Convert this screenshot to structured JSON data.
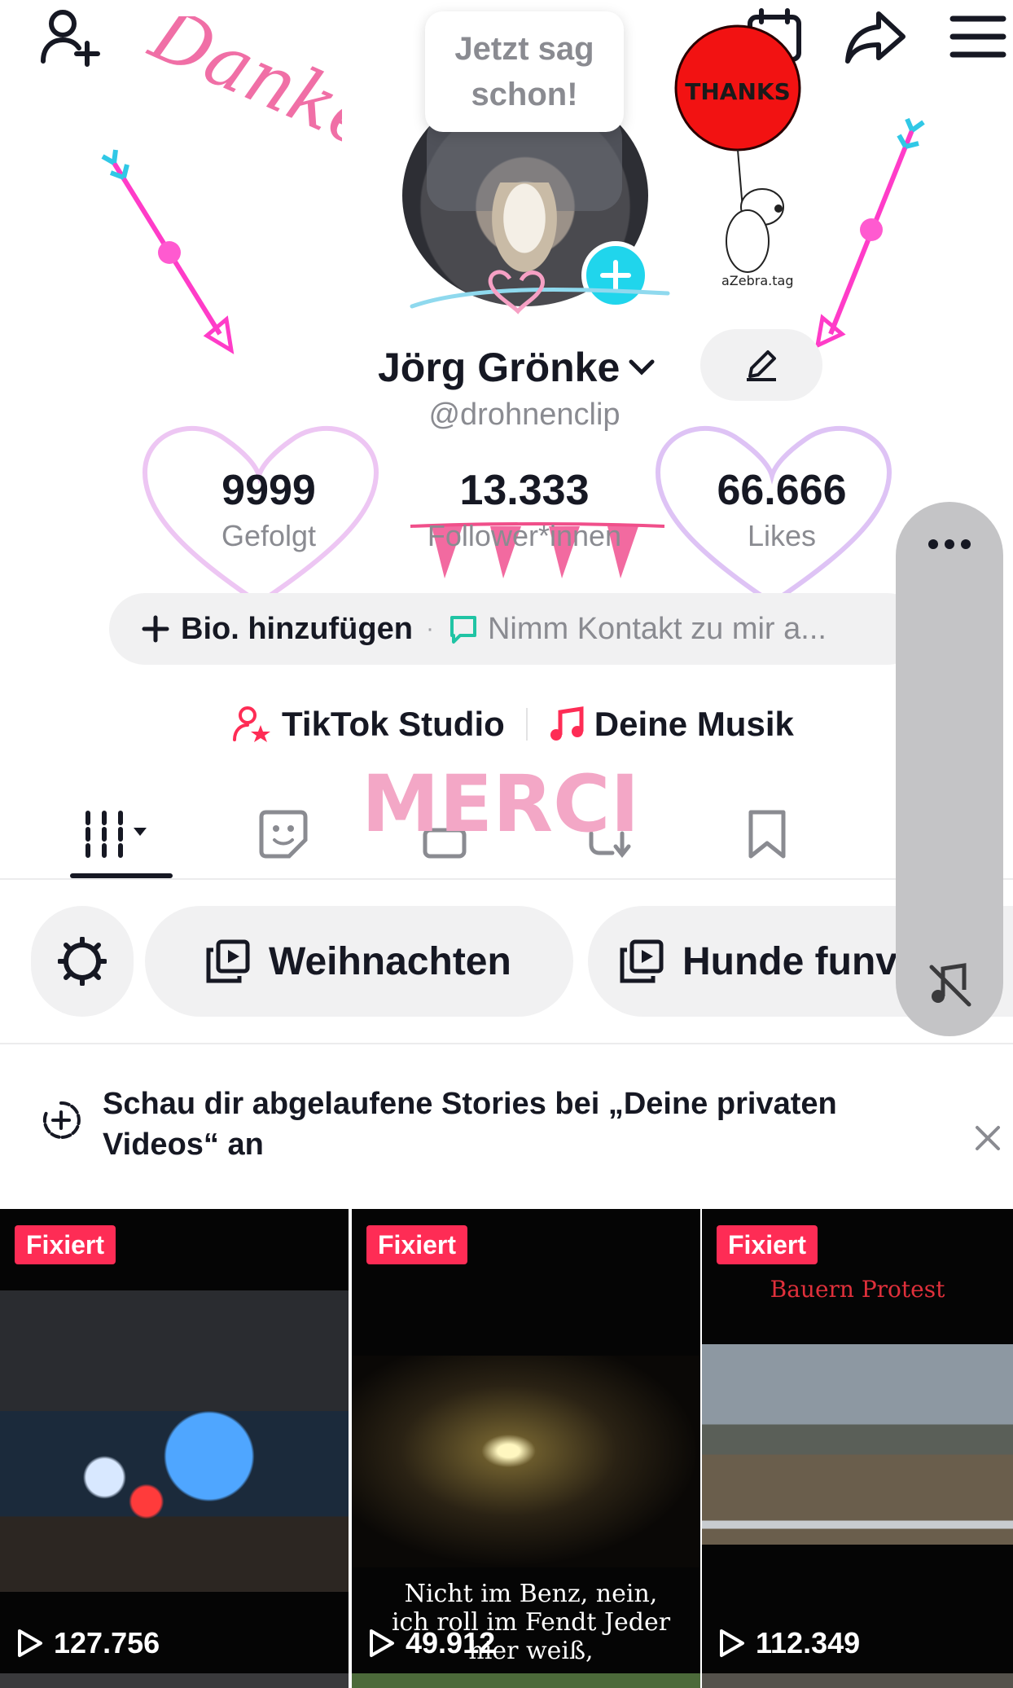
{
  "header": {
    "add_friend_icon": "person-plus-icon",
    "calendar_icon": "calendar-icon",
    "share_icon": "share-icon",
    "menu_icon": "hamburger-menu-icon"
  },
  "profile": {
    "tooltip": "Jetzt sag schon!",
    "name": "Jörg Grönke",
    "handle": "@drohnenclip"
  },
  "stats": [
    {
      "value": "9999",
      "label": "Gefolgt"
    },
    {
      "value": "13.333",
      "label": "Follower*innen"
    },
    {
      "value": "66.666",
      "label": "Likes"
    }
  ],
  "bio": {
    "add_label": "Bio. hinzufügen",
    "separator": "·",
    "contact_label": "Nimm Kontakt zu mir a..."
  },
  "links": {
    "studio": "TikTok Studio",
    "music": "Deine Musik"
  },
  "collections": {
    "chip1": "Weihnachten",
    "chip2": "Hunde funv"
  },
  "banner": {
    "text": "Schau dir abgelaufene Stories bei „Deine privaten Videos“ an"
  },
  "videos": [
    {
      "badge": "Fixiert",
      "views": "127.756",
      "caption": "",
      "title": ""
    },
    {
      "badge": "Fixiert",
      "views": "49.912",
      "caption": "Nicht im Benz, nein, ich roll im Fendt Jeder hier weiß,",
      "title": ""
    },
    {
      "badge": "Fixiert",
      "views": "112.349",
      "caption": "",
      "title": "Bauern Protest"
    }
  ],
  "stickers": {
    "danke": "Danke",
    "thanks": "THANKS",
    "merci": "MERCI",
    "zebra_tag": "aZebra.tag"
  },
  "colors": {
    "accent_red": "#fe2c55",
    "accent_cyan": "#20d5ec",
    "text_primary": "#161823",
    "text_secondary": "#8a8b91",
    "pill_bg": "#f1f1f2"
  }
}
